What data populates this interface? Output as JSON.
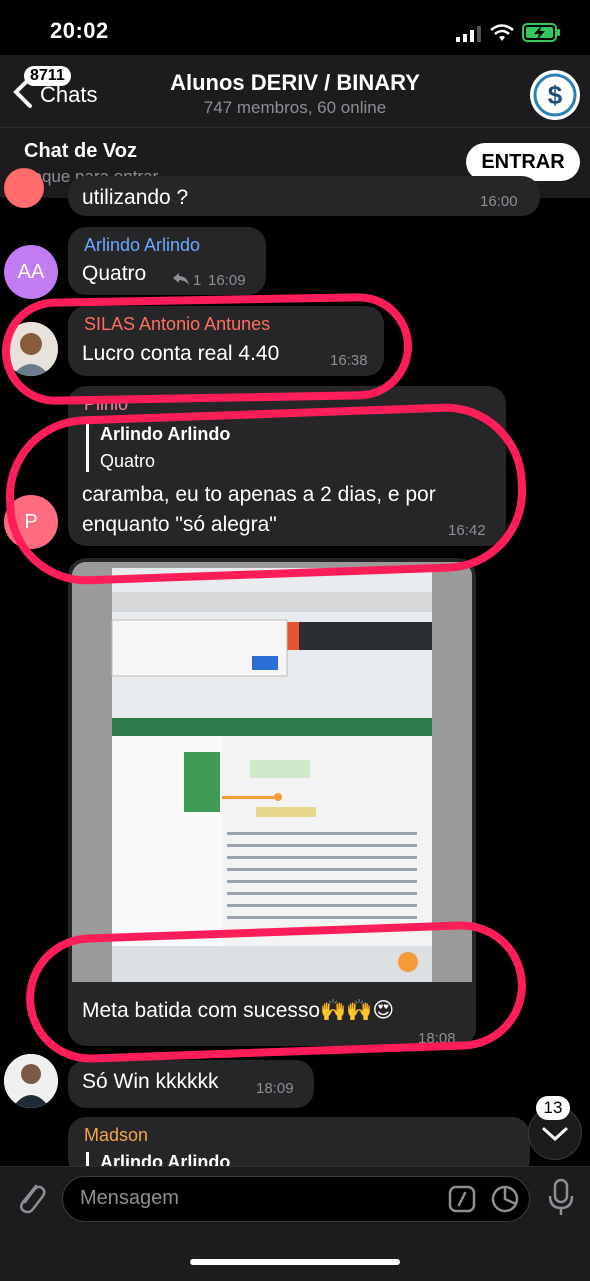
{
  "status": {
    "time": "20:02"
  },
  "header": {
    "back_label": "Chats",
    "unread_count": "8711",
    "title": "Alunos DERIV / BINARY",
    "subtitle": "747 membros, 60 online",
    "avatar_icon": "dollar-icon"
  },
  "voice_chat": {
    "title": "Chat de Voz",
    "subtitle": "Toque para entrar",
    "join_label": "ENTRAR"
  },
  "messages": [
    {
      "id": "m0",
      "text": "utilizando ?",
      "time": "16:00"
    },
    {
      "id": "m1",
      "sender": "Arlindo Arlindo",
      "sender_color": "#6aa9ff",
      "avatar_initials": "AA",
      "avatar_color": "#c07cf0",
      "text": "Quatro",
      "replies": "1",
      "time": "16:09"
    },
    {
      "id": "m2",
      "sender": "SILAS Antonio Antunes",
      "sender_color": "#ff6f61",
      "text": "Lucro conta real 4.40",
      "time": "16:38"
    },
    {
      "id": "m3",
      "sender": "Plinio",
      "sender_color": "#ff7aa2",
      "avatar_initials": "P",
      "avatar_color": "#ff6b7f",
      "reply_to": {
        "sender": "Arlindo Arlindo",
        "text": "Quatro"
      },
      "text_line1": "caramba, eu to apenas a 2 dias, e por",
      "text_line2": "enquanto \"só alegra\"",
      "time": "16:42"
    },
    {
      "id": "m4",
      "photo": "screenshot of trading bot window",
      "text": "Meta batida com sucesso🙌🙌😍",
      "time": "18:08"
    },
    {
      "id": "m5",
      "text": "Só Win kkkkkk",
      "time": "18:09"
    },
    {
      "id": "m6",
      "sender": "Madson",
      "sender_color": "#f4a54a",
      "reply_to": {
        "sender": "Arlindo Arlindo"
      }
    }
  ],
  "scroll_badge": "13",
  "composer": {
    "placeholder": "Mensagem"
  },
  "colors": {
    "annotation": "#ff1e5a",
    "bubble": "#262628",
    "accent": "#0a84ff"
  }
}
